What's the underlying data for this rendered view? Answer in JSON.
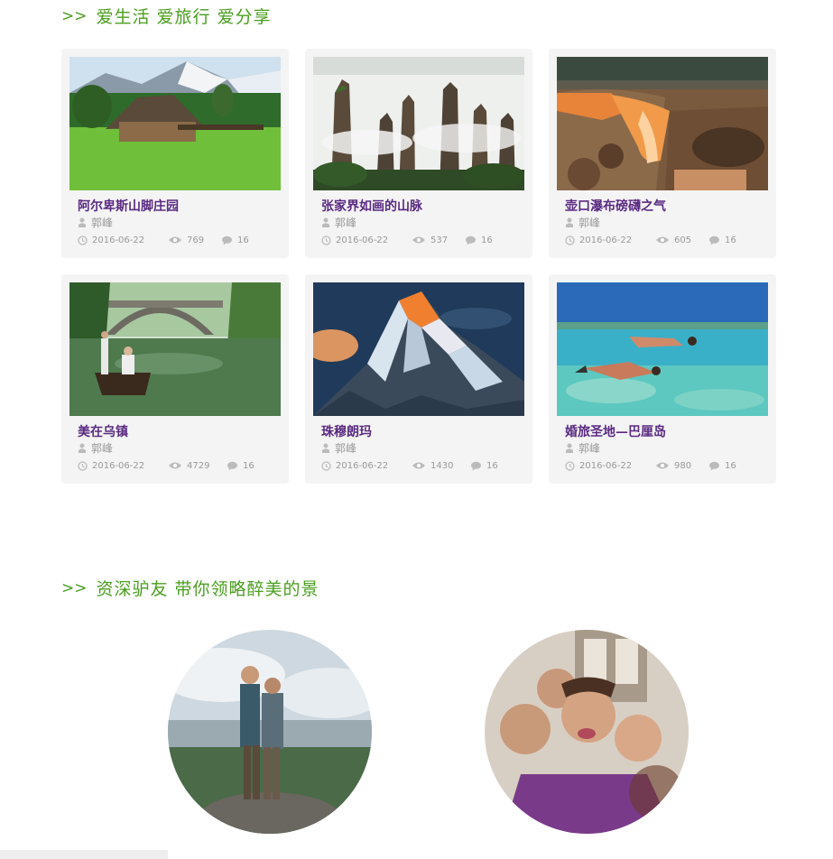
{
  "section1": {
    "chevron": ">>",
    "title": "爱生活 爱旅行 爱分享"
  },
  "section2": {
    "chevron": ">>",
    "title": "资深驴友 带你领略醉美的景"
  },
  "icons": {
    "author": "user-icon",
    "date": "clock-icon",
    "views": "eye-icon",
    "comments": "comment-icon"
  },
  "colors": {
    "accent": "#4a9e1f",
    "title": "#5a2a82",
    "meta": "#999999",
    "card_bg": "#f4f4f4"
  },
  "cards": [
    {
      "title": "阿尔卑斯山脚庄园",
      "author": "郭峰",
      "date": "2016-06-22",
      "views": "769",
      "comments": "16",
      "image": "alpine-farmhouse-photo"
    },
    {
      "title": "张家界如画的山脉",
      "author": "郭峰",
      "date": "2016-06-22",
      "views": "537",
      "comments": "16",
      "image": "zhangjiajie-mountains-photo"
    },
    {
      "title": "壶口瀑布磅礴之气",
      "author": "郭峰",
      "date": "2016-06-22",
      "views": "605",
      "comments": "16",
      "image": "hukou-waterfall-photo"
    },
    {
      "title": "美在乌镇",
      "author": "郭峰",
      "date": "2016-06-22",
      "views": "4729",
      "comments": "16",
      "image": "wuzhen-canal-photo"
    },
    {
      "title": "珠穆朗玛",
      "author": "郭峰",
      "date": "2016-06-22",
      "views": "1430",
      "comments": "16",
      "image": "everest-peak-photo"
    },
    {
      "title": "婚旅圣地—巴厘岛",
      "author": "郭峰",
      "date": "2016-06-22",
      "views": "980",
      "comments": "16",
      "image": "bali-snorkeling-photo"
    }
  ],
  "guides": [
    {
      "image": "couple-selfie-mountain-photo"
    },
    {
      "image": "group-selfie-photo"
    }
  ]
}
